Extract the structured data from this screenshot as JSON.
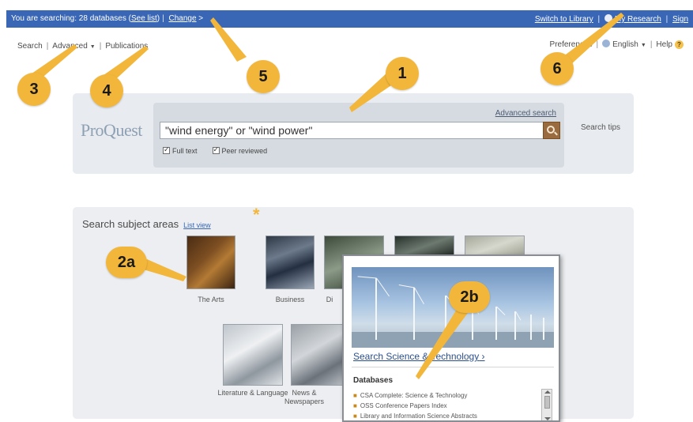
{
  "topbar": {
    "searching_prefix": "You are searching: 28 databases",
    "see_list": "See list",
    "change": "Change",
    "switch_label": "Switch to Library",
    "my_research": "My Research",
    "sign_out": "Sign"
  },
  "nav": {
    "search": "Search",
    "advanced": "Advanced",
    "publications": "Publications"
  },
  "utility": {
    "preferences": "Preferences",
    "language": "English",
    "help": "Help"
  },
  "search": {
    "logo": "ProQuest",
    "advanced_link": "Advanced search",
    "query": "\"wind energy\" or \"wind power\"",
    "full_text": "Full text",
    "peer_reviewed": "Peer reviewed",
    "tips": "Search tips"
  },
  "subjects": {
    "title": "Search subject areas",
    "list_view": "List view",
    "row1": [
      "The Arts",
      "Business",
      "Di"
    ],
    "row2": [
      "Literature & Language",
      "News & Newspapers"
    ]
  },
  "popup": {
    "link": "Search Science & Technology",
    "databases_heading": "Databases",
    "databases": [
      "CSA Complete: Science & Technology",
      "OSS Conference Papers Index",
      "Library and Information Science Abstracts"
    ]
  },
  "callouts": {
    "c1": "1",
    "c2a": "2a",
    "c2b": "2b",
    "c3": "3",
    "c4": "4",
    "c5": "5",
    "c6": "6",
    "star": "*"
  },
  "colors": {
    "topbar": "#3a67b5",
    "callout": "#f2b63b",
    "panel": "#e8ebef",
    "link": "#2b4f8c"
  }
}
